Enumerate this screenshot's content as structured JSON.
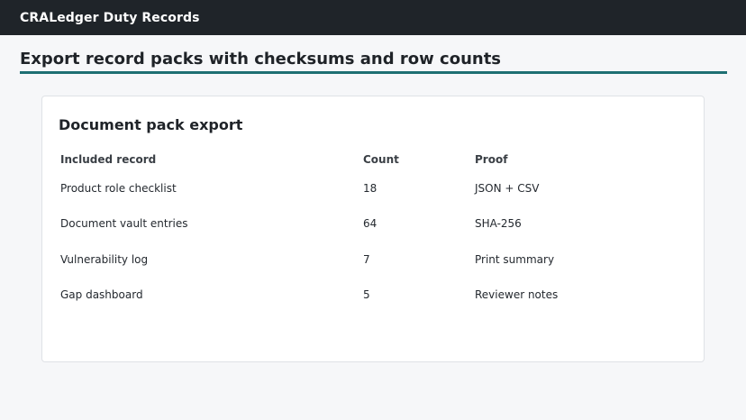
{
  "app": {
    "title": "CRALedger Duty Records"
  },
  "page": {
    "title": "Export record packs with checksums and row counts"
  },
  "card": {
    "title": "Document pack export",
    "columns": [
      "Included record",
      "Count",
      "Proof"
    ],
    "rows": [
      {
        "record": "Product role checklist",
        "count": "18",
        "proof": "JSON + CSV"
      },
      {
        "record": "Document vault entries",
        "count": "64",
        "proof": "SHA-256"
      },
      {
        "record": "Vulnerability log",
        "count": "7",
        "proof": "Print summary"
      },
      {
        "record": "Gap dashboard",
        "count": "5",
        "proof": "Reviewer notes"
      }
    ]
  },
  "colors": {
    "topbar": "#1f2429",
    "accent_rule": "#1d6f73",
    "background": "#f6f7f9"
  }
}
